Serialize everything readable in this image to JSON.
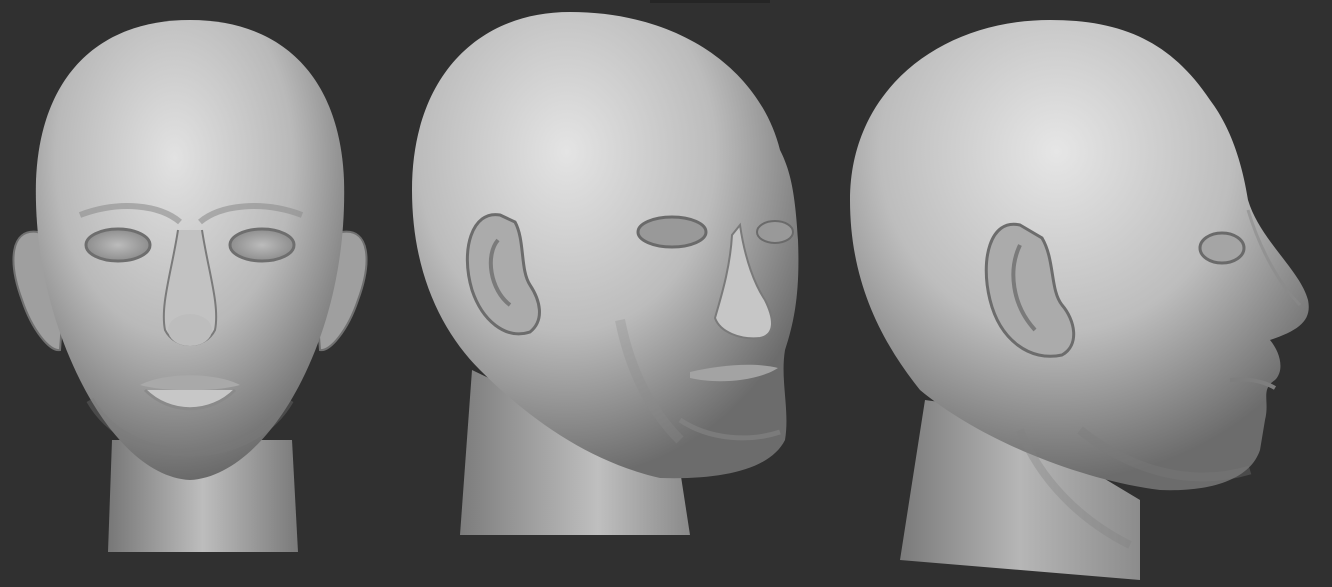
{
  "scene": {
    "description_free": true,
    "background_color": "#303030",
    "clay_light": "#d8d8d8",
    "clay_mid": "#a8a8a8",
    "clay_dark": "#5e5e5e",
    "views": [
      {
        "name": "front-view"
      },
      {
        "name": "three-quarter-view"
      },
      {
        "name": "profile-view"
      }
    ]
  }
}
